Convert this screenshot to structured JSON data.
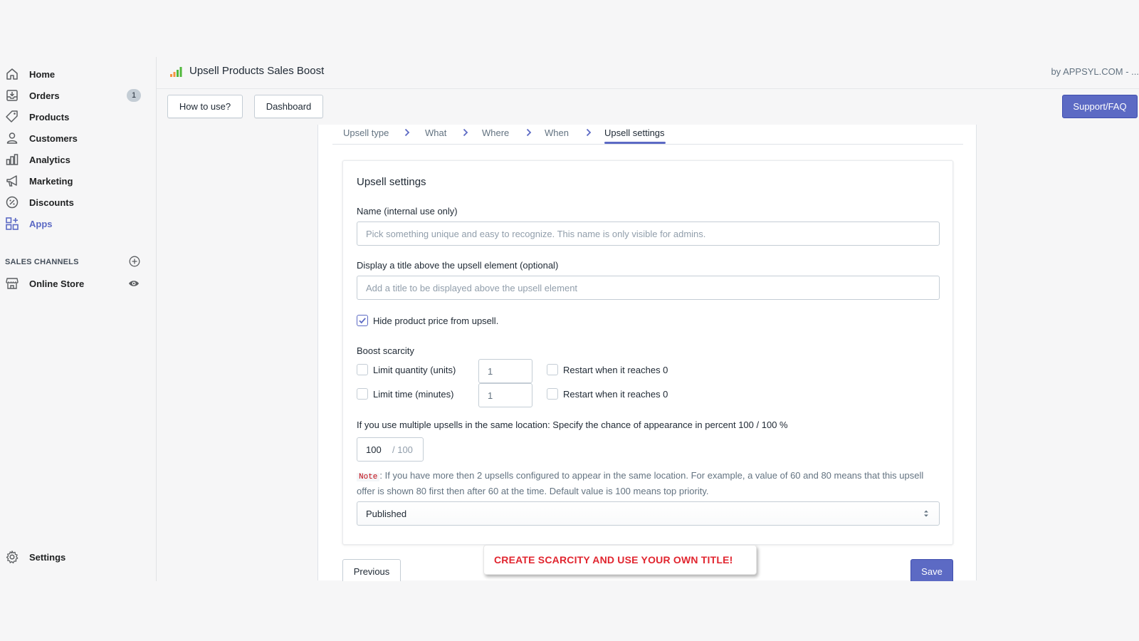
{
  "sidebar": {
    "items": [
      {
        "label": "Home",
        "icon": "home-icon"
      },
      {
        "label": "Orders",
        "icon": "orders-icon",
        "badge": "1"
      },
      {
        "label": "Products",
        "icon": "tag-icon"
      },
      {
        "label": "Customers",
        "icon": "person-icon"
      },
      {
        "label": "Analytics",
        "icon": "bar-chart-icon"
      },
      {
        "label": "Marketing",
        "icon": "megaphone-icon"
      },
      {
        "label": "Discounts",
        "icon": "discount-icon"
      },
      {
        "label": "Apps",
        "icon": "apps-icon"
      }
    ],
    "sales_channels_heading": "SALES CHANNELS",
    "online_store": "Online Store",
    "settings": "Settings"
  },
  "app": {
    "title": "Upsell Products Sales Boost",
    "by": "by APPSYL.COM - ..."
  },
  "toolbar": {
    "how_to_use": "How to use?",
    "dashboard": "Dashboard",
    "support": "Support/FAQ"
  },
  "steps": [
    "Upsell type",
    "What",
    "Where",
    "When",
    "Upsell settings"
  ],
  "form": {
    "card_title": "Upsell settings",
    "name_label": "Name (internal use only)",
    "name_placeholder": "Pick something unique and easy to recognize. This name is only visible for admins.",
    "title_label": "Display a title above the upsell element (optional)",
    "title_placeholder": "Add a title to be displayed above the upsell element",
    "hide_price_label": "Hide product price from upsell.",
    "boost_scarcity_label": "Boost scarcity",
    "limit_qty_label": "Limit quantity (units)",
    "limit_qty_value": "1",
    "limit_time_label": "Limit time (minutes)",
    "limit_time_value": "1",
    "restart_label": "Restart when it reaches 0",
    "chance_label": "If you use multiple upsells in the same location: Specify the chance of appearance in percent 100 / 100 %",
    "chance_value": "100",
    "chance_max": "/ 100",
    "note_tag": "Note",
    "note_text": ": If you have more then 2 upsells configured to appear in the same location. For example, a value of 60 and 80 means that this upsell offer is shown 80 first then after 60 at the time. Default value is 100 means top priority.",
    "status_value": "Published"
  },
  "footer": {
    "previous": "Previous",
    "save": "Save",
    "callout": "CREATE SCARCITY AND USE YOUR OWN TITLE!"
  },
  "colors": {
    "accent": "#5c6ac4",
    "callout_text": "#e1252f"
  }
}
